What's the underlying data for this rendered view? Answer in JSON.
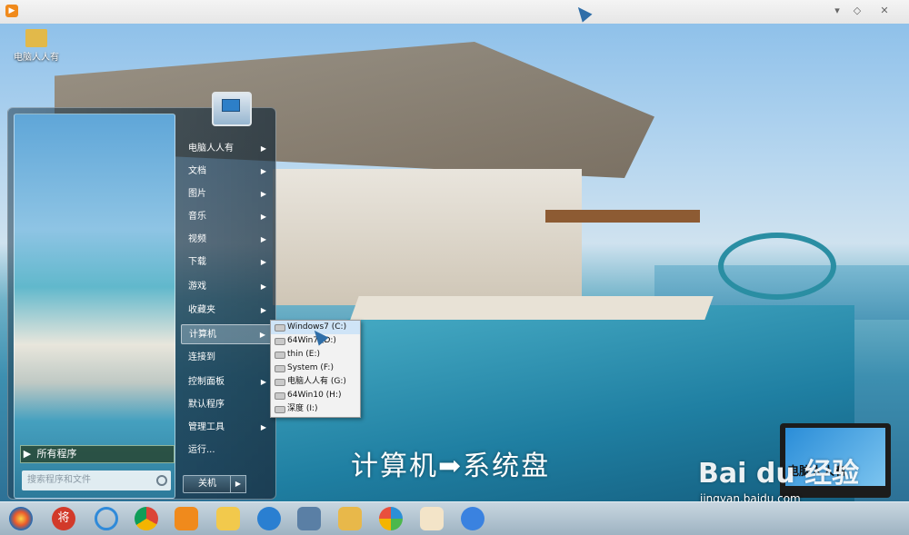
{
  "desktop": {
    "icons": [
      {
        "label": "电脑人人有"
      }
    ]
  },
  "start_menu": {
    "all_programs_label": "所有程序",
    "search_placeholder": "搜索程序和文件",
    "items": [
      {
        "label": "电脑人人有",
        "has_arrow": true
      },
      {
        "label": "文档",
        "has_arrow": true
      },
      {
        "label": "图片",
        "has_arrow": true
      },
      {
        "label": "音乐",
        "has_arrow": true
      },
      {
        "label": "视频",
        "has_arrow": true
      },
      {
        "label": "下载",
        "has_arrow": true
      },
      {
        "label": "游戏",
        "has_arrow": true
      },
      {
        "label": "收藏夹",
        "has_arrow": true
      },
      {
        "label": "计算机",
        "has_arrow": true
      },
      {
        "label": "连接到",
        "has_arrow": false
      },
      {
        "label": "控制面板",
        "has_arrow": true
      },
      {
        "label": "默认程序",
        "has_arrow": false
      },
      {
        "label": "管理工具",
        "has_arrow": true
      },
      {
        "label": "运行...",
        "has_arrow": false
      }
    ],
    "shutdown_label": "关机"
  },
  "computer_submenu": {
    "drives": [
      {
        "label": "Windows7 (C:)"
      },
      {
        "label": "64Win7 (D:)"
      },
      {
        "label": "thin (E:)"
      },
      {
        "label": "System (F:)"
      },
      {
        "label": "电脑人人有 (G:)"
      },
      {
        "label": "64Win10 (H:)"
      },
      {
        "label": "深度 (I:)"
      }
    ]
  },
  "caption": "计算机➡系统盘",
  "watermark": {
    "brand": "Bai du 经验",
    "url": "jingyan.baidu.com"
  },
  "laptop_thumbnail": {
    "text": "电脑人人有"
  },
  "taskbar": {
    "icons": [
      "start-orb-icon",
      "jiang-icon",
      "ie-icon",
      "chrome-icon",
      "media-player-icon",
      "folder-arrow-icon",
      "browser-icon",
      "remote-desktop-icon",
      "file-explorer-icon",
      "pinwheel-icon",
      "paint-icon",
      "app-icon"
    ]
  }
}
